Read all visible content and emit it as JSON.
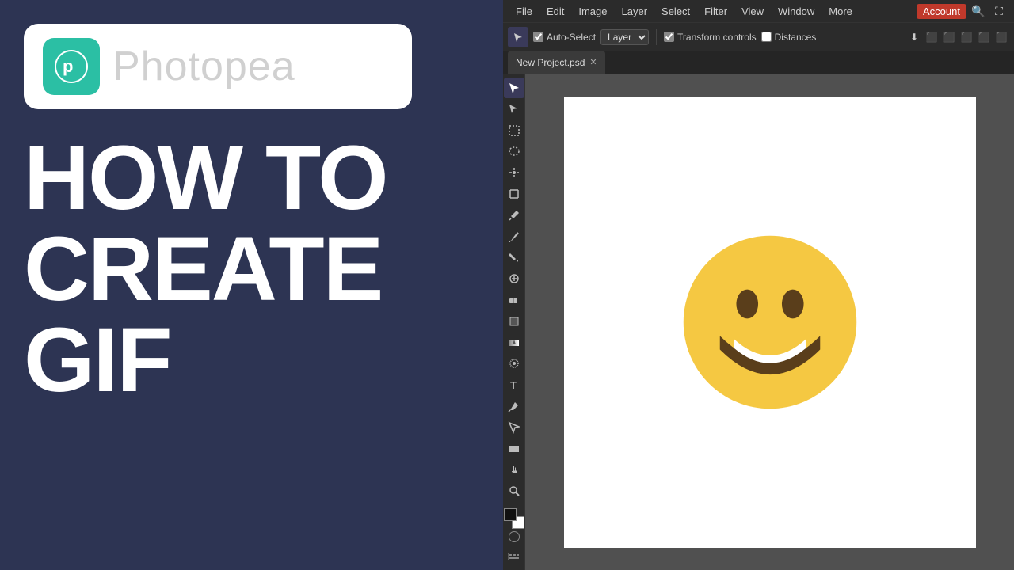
{
  "left": {
    "logo_text": "Photopea",
    "headline": "HOW TO\nCREATE\nGIF"
  },
  "editor": {
    "menu": {
      "items": [
        "File",
        "Edit",
        "Image",
        "Layer",
        "Select",
        "Filter",
        "View",
        "Window",
        "More"
      ],
      "account_label": "Account"
    },
    "toolbar": {
      "auto_select_label": "Auto-Select",
      "auto_select_checked": true,
      "layer_dropdown": "Layer",
      "transform_controls_label": "Transform controls",
      "transform_checked": true,
      "distances_label": "Distances",
      "distances_checked": false
    },
    "tab": {
      "name": "New Project.psd"
    },
    "tools": [
      "↖",
      "↗",
      "⬚",
      "⬭",
      "✳",
      "⬜",
      "✏",
      "🪣",
      "✏",
      "⬇",
      "◌",
      "▪",
      "💧",
      "•",
      "T",
      "✒",
      "↗",
      "▭",
      "✋",
      "🔍"
    ]
  }
}
